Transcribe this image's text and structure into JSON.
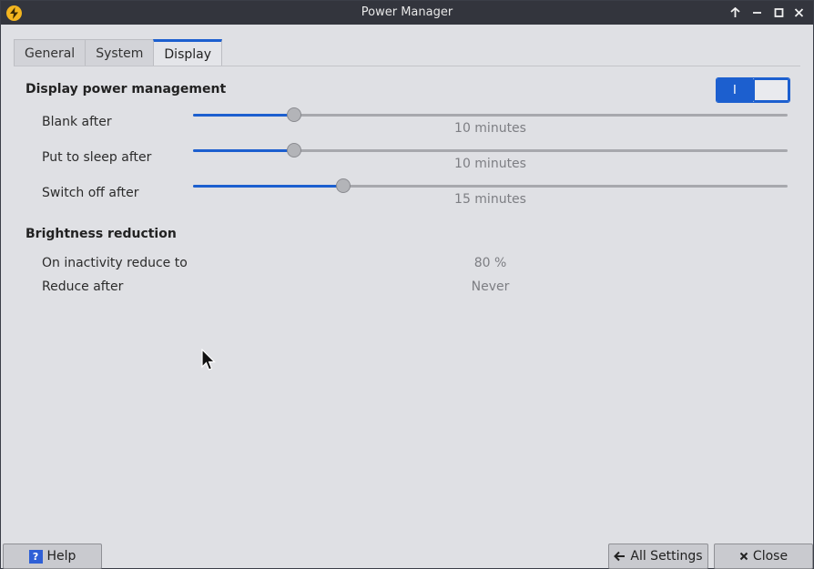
{
  "window": {
    "title": "Power Manager",
    "app_icon": "lightning-bolt-icon",
    "controls": [
      "keep-above-icon",
      "minimize-icon",
      "maximize-icon",
      "close-icon"
    ]
  },
  "tabs": [
    {
      "label": "General",
      "active": false
    },
    {
      "label": "System",
      "active": false
    },
    {
      "label": "Display",
      "active": true
    }
  ],
  "display_power": {
    "heading": "Display power management",
    "toggle_on_glyph": "I",
    "enabled": true,
    "rows": [
      {
        "label": "Blank after",
        "value_text": "10 minutes",
        "fraction": 0.17
      },
      {
        "label": "Put to sleep after",
        "value_text": "10 minutes",
        "fraction": 0.17
      },
      {
        "label": "Switch off after",
        "value_text": "15 minutes",
        "fraction": 0.252
      }
    ]
  },
  "brightness": {
    "heading": "Brightness reduction",
    "rows": [
      {
        "label": "On inactivity reduce to",
        "value_text": "80 %"
      },
      {
        "label": "Reduce after",
        "value_text": "Never"
      }
    ]
  },
  "buttons": {
    "help": "Help",
    "all_settings": "All Settings",
    "close": "Close"
  },
  "colors": {
    "accent": "#1c5fcf",
    "titlebar": "#33353d",
    "window_bg": "#dfe0e4",
    "app_icon": "#f3b51f"
  }
}
